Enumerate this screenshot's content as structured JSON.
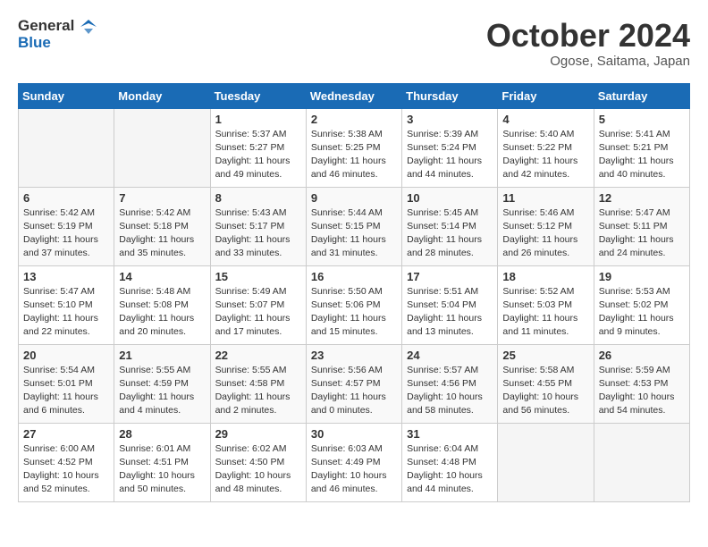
{
  "header": {
    "logo_general": "General",
    "logo_blue": "Blue",
    "month_title": "October 2024",
    "location": "Ogose, Saitama, Japan"
  },
  "weekdays": [
    "Sunday",
    "Monday",
    "Tuesday",
    "Wednesday",
    "Thursday",
    "Friday",
    "Saturday"
  ],
  "weeks": [
    [
      null,
      null,
      {
        "day": 1,
        "sunrise": "5:37 AM",
        "sunset": "5:27 PM",
        "daylight": "11 hours and 49 minutes."
      },
      {
        "day": 2,
        "sunrise": "5:38 AM",
        "sunset": "5:25 PM",
        "daylight": "11 hours and 46 minutes."
      },
      {
        "day": 3,
        "sunrise": "5:39 AM",
        "sunset": "5:24 PM",
        "daylight": "11 hours and 44 minutes."
      },
      {
        "day": 4,
        "sunrise": "5:40 AM",
        "sunset": "5:22 PM",
        "daylight": "11 hours and 42 minutes."
      },
      {
        "day": 5,
        "sunrise": "5:41 AM",
        "sunset": "5:21 PM",
        "daylight": "11 hours and 40 minutes."
      }
    ],
    [
      {
        "day": 6,
        "sunrise": "5:42 AM",
        "sunset": "5:19 PM",
        "daylight": "11 hours and 37 minutes."
      },
      {
        "day": 7,
        "sunrise": "5:42 AM",
        "sunset": "5:18 PM",
        "daylight": "11 hours and 35 minutes."
      },
      {
        "day": 8,
        "sunrise": "5:43 AM",
        "sunset": "5:17 PM",
        "daylight": "11 hours and 33 minutes."
      },
      {
        "day": 9,
        "sunrise": "5:44 AM",
        "sunset": "5:15 PM",
        "daylight": "11 hours and 31 minutes."
      },
      {
        "day": 10,
        "sunrise": "5:45 AM",
        "sunset": "5:14 PM",
        "daylight": "11 hours and 28 minutes."
      },
      {
        "day": 11,
        "sunrise": "5:46 AM",
        "sunset": "5:12 PM",
        "daylight": "11 hours and 26 minutes."
      },
      {
        "day": 12,
        "sunrise": "5:47 AM",
        "sunset": "5:11 PM",
        "daylight": "11 hours and 24 minutes."
      }
    ],
    [
      {
        "day": 13,
        "sunrise": "5:47 AM",
        "sunset": "5:10 PM",
        "daylight": "11 hours and 22 minutes."
      },
      {
        "day": 14,
        "sunrise": "5:48 AM",
        "sunset": "5:08 PM",
        "daylight": "11 hours and 20 minutes."
      },
      {
        "day": 15,
        "sunrise": "5:49 AM",
        "sunset": "5:07 PM",
        "daylight": "11 hours and 17 minutes."
      },
      {
        "day": 16,
        "sunrise": "5:50 AM",
        "sunset": "5:06 PM",
        "daylight": "11 hours and 15 minutes."
      },
      {
        "day": 17,
        "sunrise": "5:51 AM",
        "sunset": "5:04 PM",
        "daylight": "11 hours and 13 minutes."
      },
      {
        "day": 18,
        "sunrise": "5:52 AM",
        "sunset": "5:03 PM",
        "daylight": "11 hours and 11 minutes."
      },
      {
        "day": 19,
        "sunrise": "5:53 AM",
        "sunset": "5:02 PM",
        "daylight": "11 hours and 9 minutes."
      }
    ],
    [
      {
        "day": 20,
        "sunrise": "5:54 AM",
        "sunset": "5:01 PM",
        "daylight": "11 hours and 6 minutes."
      },
      {
        "day": 21,
        "sunrise": "5:55 AM",
        "sunset": "4:59 PM",
        "daylight": "11 hours and 4 minutes."
      },
      {
        "day": 22,
        "sunrise": "5:55 AM",
        "sunset": "4:58 PM",
        "daylight": "11 hours and 2 minutes."
      },
      {
        "day": 23,
        "sunrise": "5:56 AM",
        "sunset": "4:57 PM",
        "daylight": "11 hours and 0 minutes."
      },
      {
        "day": 24,
        "sunrise": "5:57 AM",
        "sunset": "4:56 PM",
        "daylight": "10 hours and 58 minutes."
      },
      {
        "day": 25,
        "sunrise": "5:58 AM",
        "sunset": "4:55 PM",
        "daylight": "10 hours and 56 minutes."
      },
      {
        "day": 26,
        "sunrise": "5:59 AM",
        "sunset": "4:53 PM",
        "daylight": "10 hours and 54 minutes."
      }
    ],
    [
      {
        "day": 27,
        "sunrise": "6:00 AM",
        "sunset": "4:52 PM",
        "daylight": "10 hours and 52 minutes."
      },
      {
        "day": 28,
        "sunrise": "6:01 AM",
        "sunset": "4:51 PM",
        "daylight": "10 hours and 50 minutes."
      },
      {
        "day": 29,
        "sunrise": "6:02 AM",
        "sunset": "4:50 PM",
        "daylight": "10 hours and 48 minutes."
      },
      {
        "day": 30,
        "sunrise": "6:03 AM",
        "sunset": "4:49 PM",
        "daylight": "10 hours and 46 minutes."
      },
      {
        "day": 31,
        "sunrise": "6:04 AM",
        "sunset": "4:48 PM",
        "daylight": "10 hours and 44 minutes."
      },
      null,
      null
    ]
  ]
}
